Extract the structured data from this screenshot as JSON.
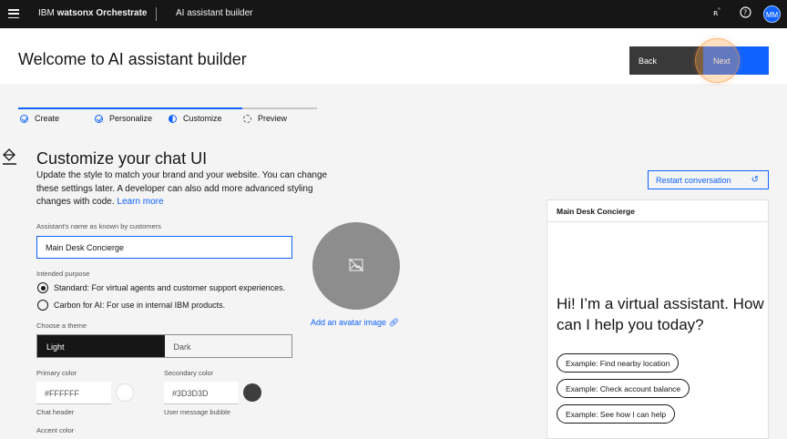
{
  "topbar": {
    "brand_prefix": "IBM ",
    "brand_name": "watsonx Orchestrate",
    "app_name": "AI assistant builder",
    "avatar_initials": "MM",
    "icons": [
      "menu-icon",
      "notification-icon",
      "help-icon",
      "user-avatar"
    ]
  },
  "header": {
    "title": "Welcome to AI assistant builder",
    "back_label": "Back",
    "next_label": "Next"
  },
  "progress": {
    "steps": [
      {
        "label": "Create",
        "state": "complete"
      },
      {
        "label": "Personalize",
        "state": "complete"
      },
      {
        "label": "Customize",
        "state": "current"
      },
      {
        "label": "Preview",
        "state": "incomplete"
      }
    ]
  },
  "customize": {
    "title": "Customize your chat UI",
    "description": "Update the style to match your brand and your website. You can change these settings later. A developer can also add more advanced styling changes with code.",
    "learn_more": "Learn more",
    "name_label": "Assistant's name as known by customers",
    "name_value": "Main Desk Concierge",
    "purpose_label": "Intended purpose",
    "purpose_options": [
      {
        "label": "Standard: For virtual agents and customer support experiences.",
        "selected": true
      },
      {
        "label": "Carbon for AI: For use in internal IBM products.",
        "selected": false
      }
    ],
    "theme_label": "Choose a theme",
    "theme_options": [
      "Light",
      "Dark"
    ],
    "theme_selected": "Light",
    "primary_color_label": "Primary color",
    "primary_color_value": "#FFFFFF",
    "primary_color_helper": "Chat header",
    "secondary_color_label": "Secondary color",
    "secondary_color_value": "#3D3D3D",
    "secondary_color_helper": "User message bubble",
    "accent_color_label": "Accent color",
    "add_avatar": "Add an avatar image"
  },
  "preview": {
    "restart_label": "Restart conversation",
    "chat_title": "Main Desk Concierge",
    "greeting": "Hi! I’m a virtual assistant. How can I help you today?",
    "chips": [
      "Example: Find nearby location",
      "Example: Check account balance",
      "Example: See how I can help"
    ]
  },
  "colors": {
    "accent": "#0f62fe",
    "topbar_bg": "#161616",
    "next_highlight": "#ffa64d"
  }
}
